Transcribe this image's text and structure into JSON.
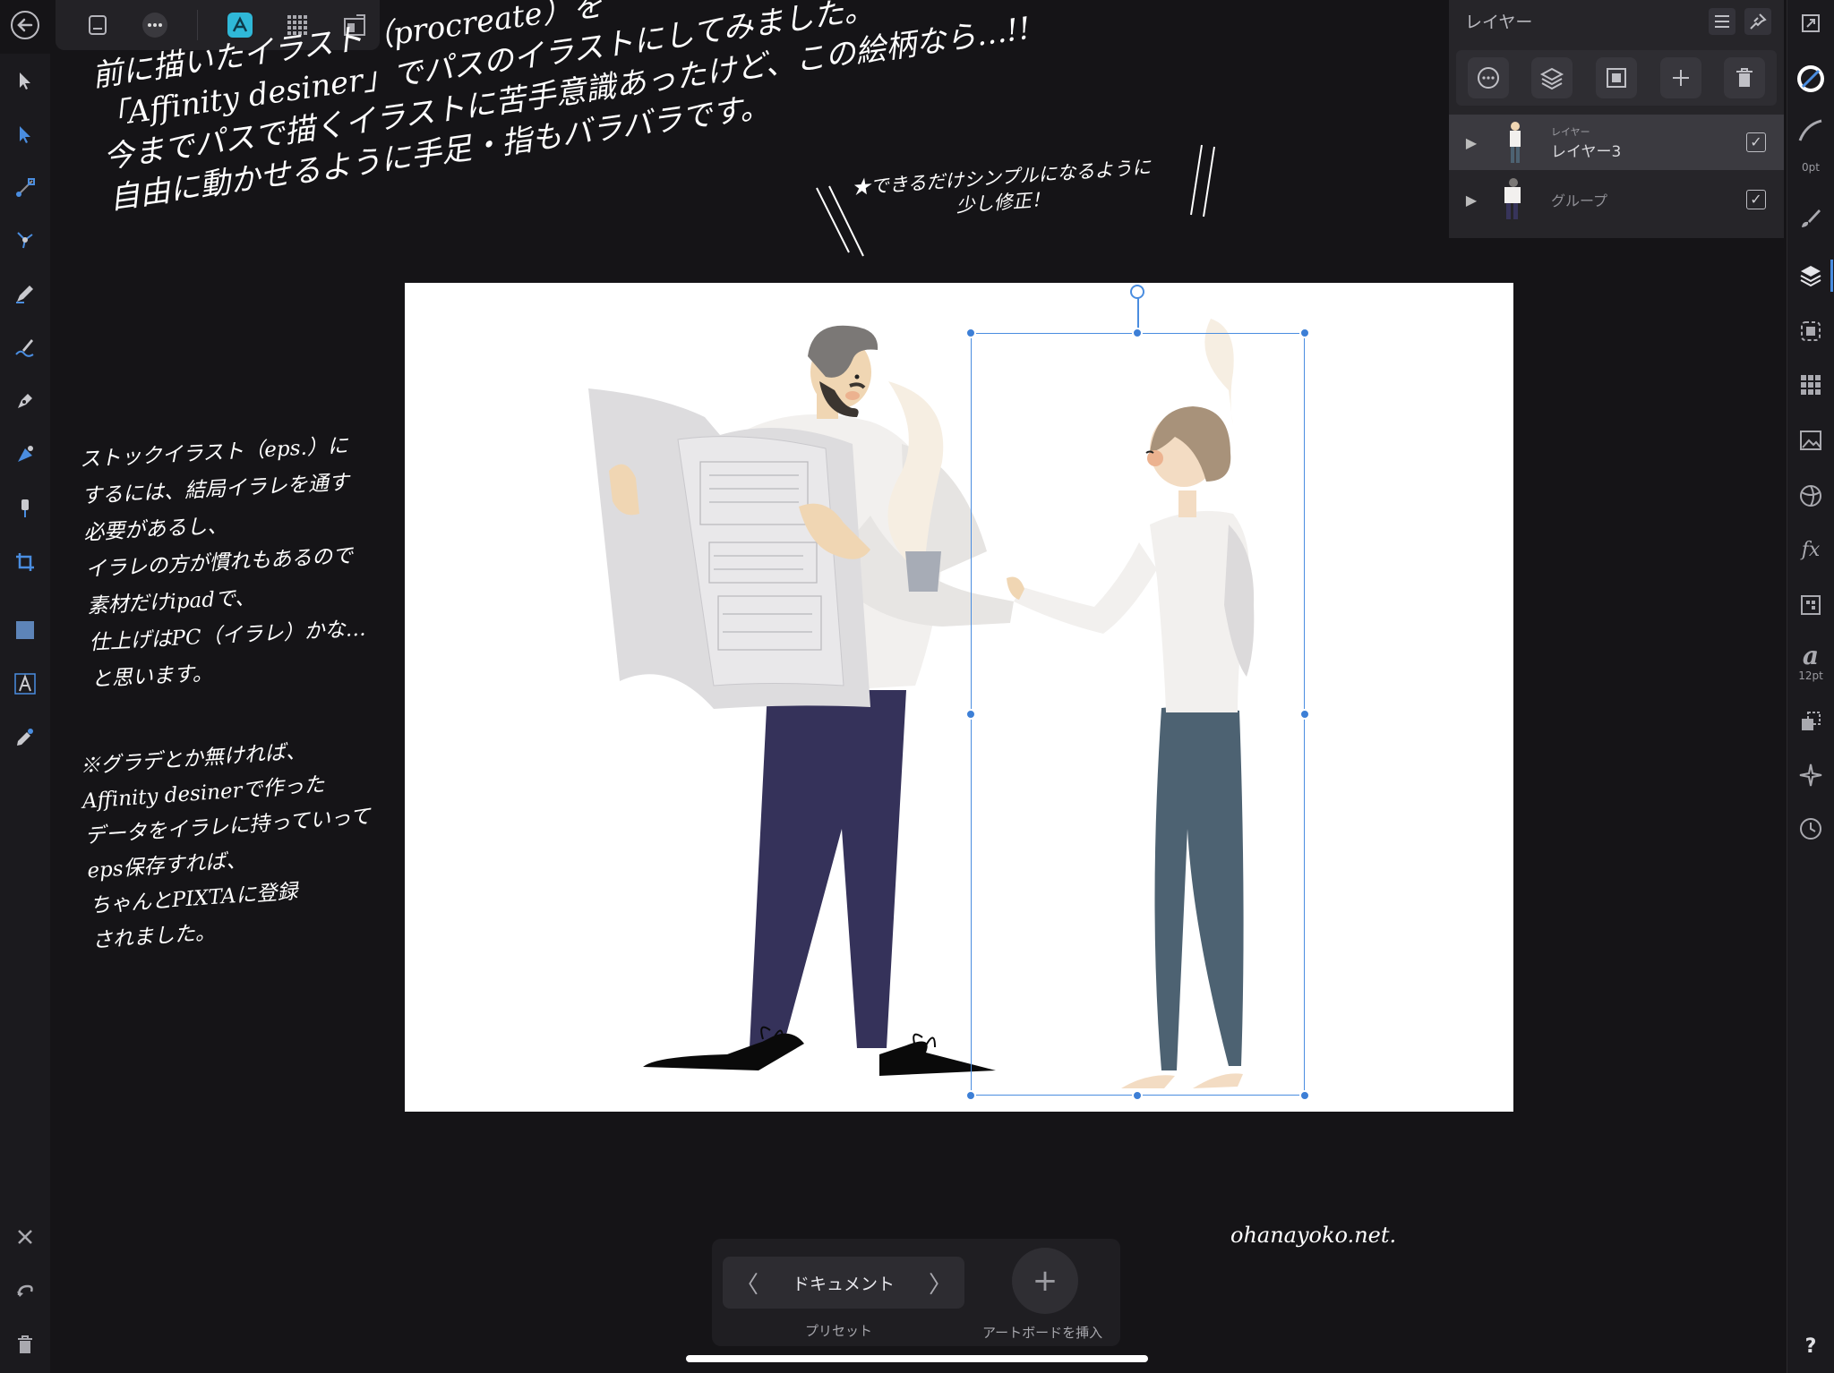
{
  "colors": {
    "accent": "#3d7fd6",
    "canvas_bg": "#151417",
    "panel_bg": "#262529",
    "artboard_bg": "#ffffff"
  },
  "top_toolbar": {
    "back_icon": "back-arrow-icon",
    "items": [
      "document-icon",
      "more-icon",
      "affinity-persona-icon",
      "grid-icon",
      "export-persona-icon"
    ]
  },
  "left_tools": [
    "move-tool-icon",
    "node-tool-icon",
    "corner-tool-icon",
    "point-transform-icon",
    "pencil-icon",
    "vector-brush-icon",
    "pen-tool-icon",
    "fill-tool-icon",
    "transparency-tool-icon",
    "crop-icon",
    "rectangle-icon",
    "text-tool-icon",
    "color-picker-icon"
  ],
  "left_bottom": [
    "close-icon",
    "undo-icon",
    "trash-icon"
  ],
  "layers_panel": {
    "title": "レイヤー",
    "tools": [
      "more-icon",
      "layer-stack-icon",
      "mask-icon",
      "add-icon",
      "trash-icon"
    ],
    "rows": [
      {
        "kind": "レイヤー",
        "name": "レイヤー3",
        "checked": "✓"
      },
      {
        "kind": "",
        "name": "グループ",
        "checked": "✓"
      }
    ]
  },
  "studio": {
    "stroke_label": "0pt",
    "font_label": "12pt",
    "icons": [
      "resize-icon",
      "no-fill-icon",
      "stroke-icon",
      "brush-icon",
      "layers-icon",
      "selection-icon",
      "swatches-icon",
      "image-icon",
      "appearance-icon",
      "fx-icon",
      "transform-icon",
      "font-icon",
      "constraints-icon",
      "snapping-icon",
      "history-icon",
      "help-icon"
    ],
    "help": "?"
  },
  "annotations": {
    "top_note": "前に描いたイラスト（procreate）を\n「Affinity desiner」でパスのイラストにしてみました。\n今までパスで描くイラストに苦手意識あったけど、この絵柄なら…!!\n自由に動かせるように手足・指もバラバラです。",
    "star_note": "★できるだけシンプルになるように\n少し修正！",
    "left_note": "ストックイラスト（eps.）に\nするには、結局イラレを通す\n必要があるし、\nイラレの方が慣れもあるので\n素材だけipadで、\n仕上げはPC（イラレ）かな…\nと思います。",
    "left_note2": "※グラデとか無ければ、\nAffinity desinerで作った\nデータをイラレに持っていって\neps保存すれば、\nちゃんとPIXTAに登録\nされました。",
    "signature": "ohanayoko.net."
  },
  "context_bar": {
    "document_label": "ドキュメント",
    "preset_label": "プリセット",
    "insert_artboard_label": "アートボードを挿入",
    "plus": "+"
  }
}
